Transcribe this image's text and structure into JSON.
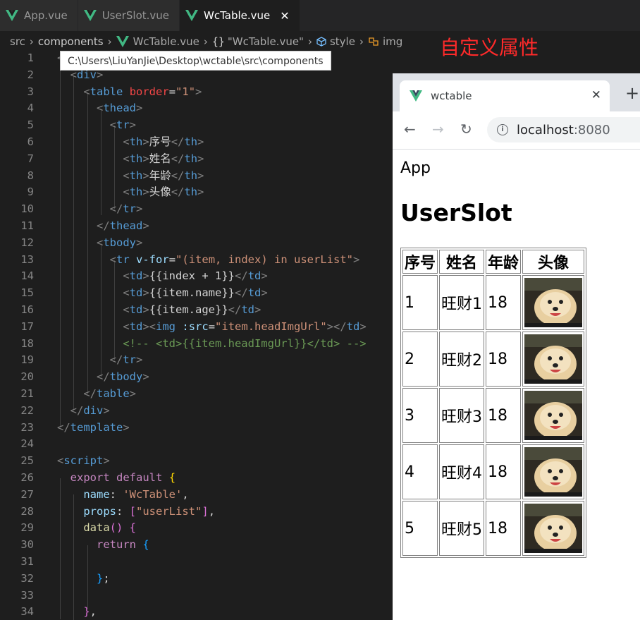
{
  "editor": {
    "tabs": [
      {
        "label": "App.vue",
        "active": false
      },
      {
        "label": "UserSlot.vue",
        "active": false
      },
      {
        "label": "WcTable.vue",
        "active": true
      }
    ],
    "breadcrumb": {
      "items": [
        "src",
        "components",
        "WcTable.vue",
        "\"WcTable.vue\"",
        "style",
        "img"
      ],
      "braces": "{}"
    },
    "tooltip": "C:\\Users\\LiuYanJie\\Desktop\\wctable\\src\\components",
    "annotation": "自定义属性",
    "line_numbers": [
      "1",
      "2",
      "3",
      "4",
      "5",
      "6",
      "7",
      "8",
      "9",
      "10",
      "11",
      "12",
      "13",
      "14",
      "15",
      "16",
      "17",
      "18",
      "19",
      "20",
      "21",
      "22",
      "23",
      "24",
      "25",
      "26",
      "27",
      "28",
      "29",
      "30",
      "31",
      "32",
      "33",
      "34"
    ]
  },
  "browser": {
    "tab_title": "wctable",
    "url_host": "localhost",
    "url_port": ":8080",
    "page": {
      "app_text": "App",
      "heading": "UserSlot",
      "table": {
        "headers": [
          "序号",
          "姓名",
          "年龄",
          "头像"
        ],
        "rows": [
          {
            "index": "1",
            "name": "旺财1",
            "age": "18"
          },
          {
            "index": "2",
            "name": "旺财2",
            "age": "18"
          },
          {
            "index": "3",
            "name": "旺财3",
            "age": "18"
          },
          {
            "index": "4",
            "name": "旺财4",
            "age": "18"
          },
          {
            "index": "5",
            "name": "旺财5",
            "age": "18"
          }
        ]
      }
    }
  },
  "colors": {
    "vue_green": "#41b883",
    "vue_dark": "#35495e",
    "annotation_red": "#ff2a2a"
  }
}
